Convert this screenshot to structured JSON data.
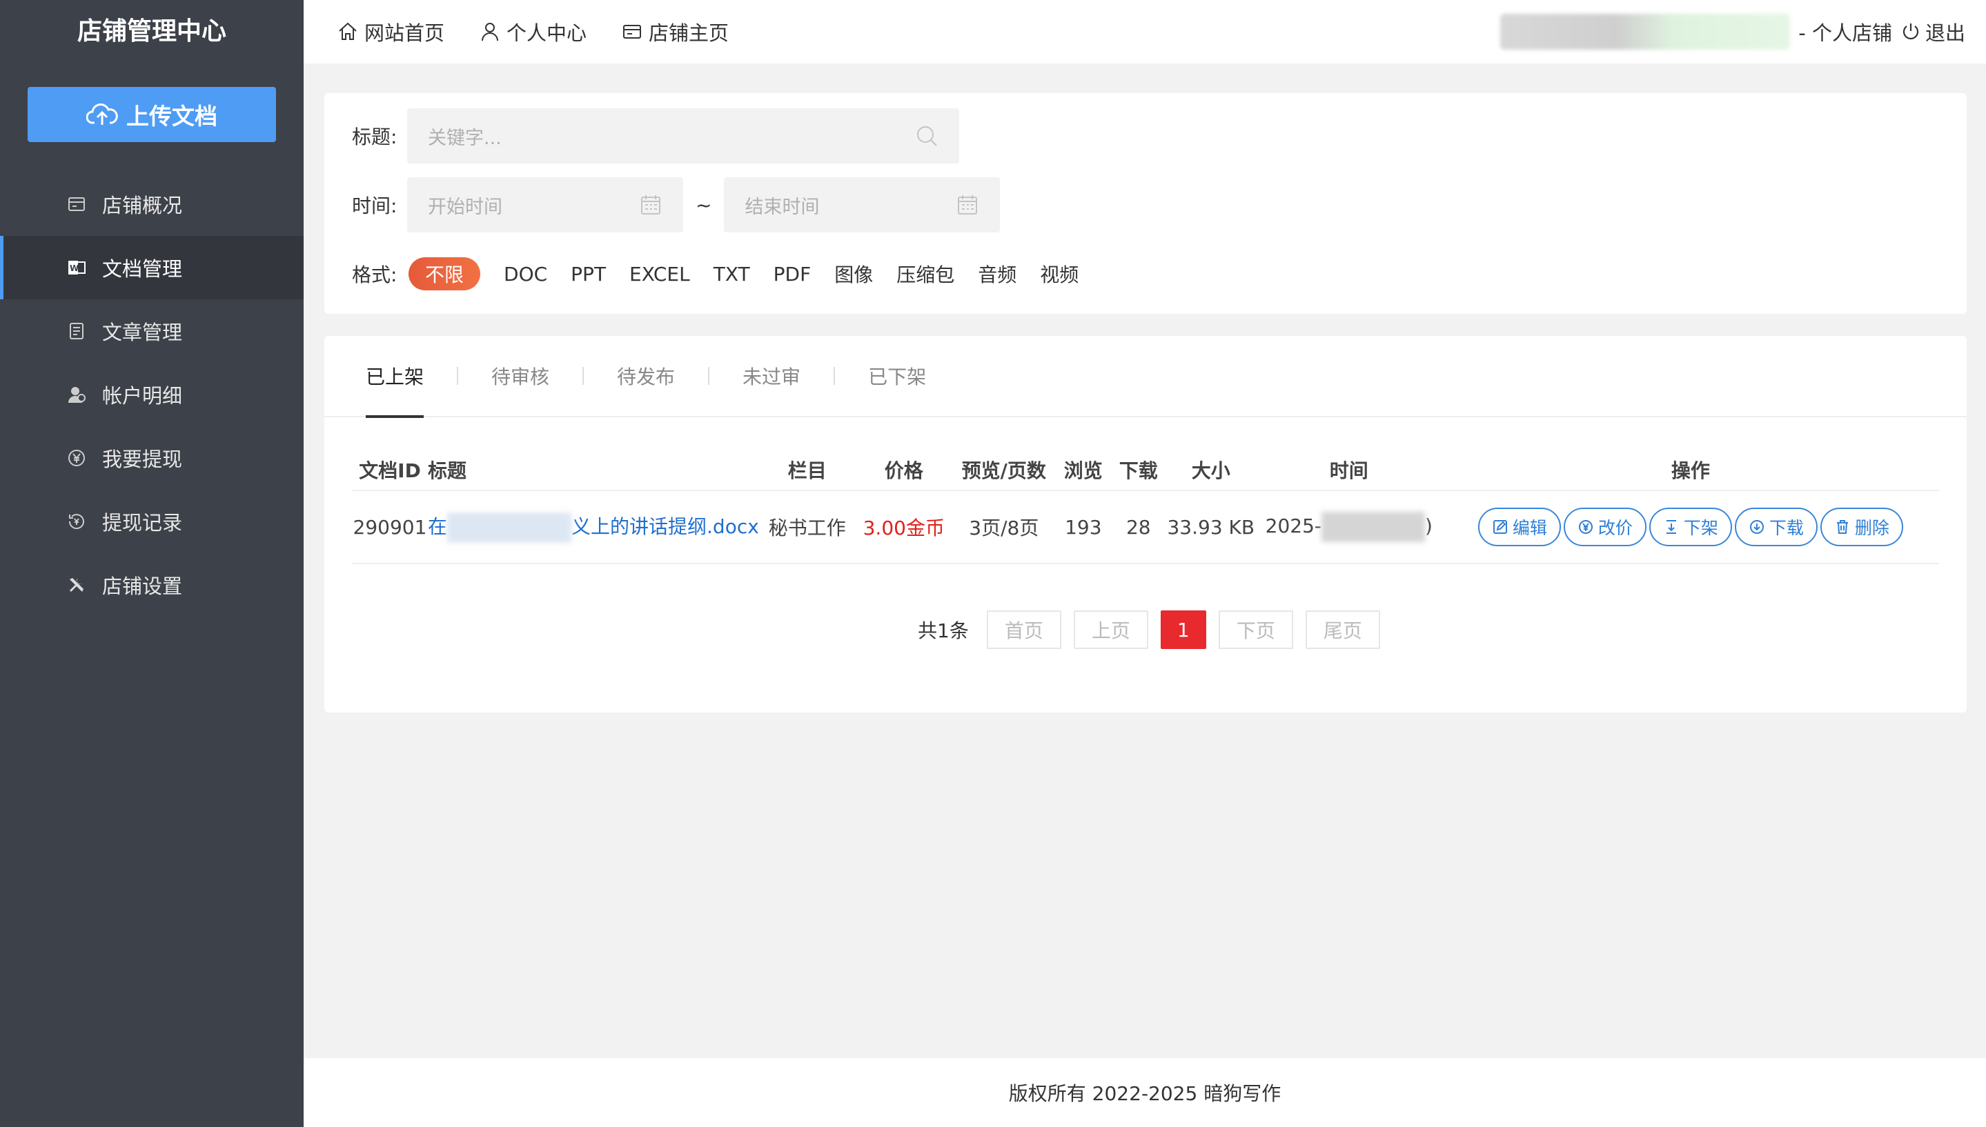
{
  "sidebar": {
    "title": "店铺管理中心",
    "upload_label": "上传文档",
    "items": [
      {
        "label": "店铺概况",
        "icon": "store-icon"
      },
      {
        "label": "文档管理",
        "icon": "word-doc-icon",
        "active": true
      },
      {
        "label": "文章管理",
        "icon": "article-icon"
      },
      {
        "label": "帐户明细",
        "icon": "user-account-icon"
      },
      {
        "label": "我要提现",
        "icon": "yuan-icon"
      },
      {
        "label": "提现记录",
        "icon": "withdraw-record-icon"
      },
      {
        "label": "店铺设置",
        "icon": "tools-icon"
      }
    ]
  },
  "topbar": {
    "links": [
      {
        "label": "网站首页",
        "icon": "home-icon"
      },
      {
        "label": "个人中心",
        "icon": "user-icon"
      },
      {
        "label": "店铺主页",
        "icon": "shop-icon"
      }
    ],
    "shop_label": "- 个人店铺",
    "logout_label": "退出"
  },
  "filters": {
    "title_label": "标题:",
    "title_placeholder": "关键字...",
    "time_label": "时间:",
    "start_placeholder": "开始时间",
    "end_placeholder": "结束时间",
    "tilde": "~",
    "format_label": "格式:",
    "formats": [
      "不限",
      "DOC",
      "PPT",
      "EXCEL",
      "TXT",
      "PDF",
      "图像",
      "压缩包",
      "音频",
      "视频"
    ],
    "active_format": "不限"
  },
  "tabs": [
    "已上架",
    "待审核",
    "待发布",
    "未过审",
    "已下架"
  ],
  "active_tab": "已上架",
  "table": {
    "headers": [
      "文档ID",
      "标题",
      "栏目",
      "价格",
      "预览/页数",
      "浏览",
      "下载",
      "大小",
      "时间",
      "操作"
    ],
    "rows": [
      {
        "id": "290901",
        "title_start": "在",
        "title_end": "义上的讲话提纲.docx",
        "column": "秘书工作",
        "price": "3.00金币",
        "pages": "3页/8页",
        "views": "193",
        "downloads": "28",
        "size": "33.93 KB",
        "time_start": "2025-",
        "time_end": ")"
      }
    ],
    "ops": [
      {
        "label": "编辑",
        "icon": "edit-icon"
      },
      {
        "label": "改价",
        "icon": "price-icon"
      },
      {
        "label": "下架",
        "icon": "unshelve-icon"
      },
      {
        "label": "下载",
        "icon": "download-icon"
      },
      {
        "label": "删除",
        "icon": "trash-icon"
      }
    ]
  },
  "pagination": {
    "total": "共1条",
    "first": "首页",
    "prev": "上页",
    "current": "1",
    "next": "下页",
    "last": "尾页"
  },
  "footer": "版权所有 2022-2025 暗狗写作",
  "colors": {
    "sidebar_bg": "#3d4149",
    "accent": "#4f9cf4",
    "price": "#e0221b",
    "active_format": "#e55a3a",
    "page_current": "#e8292d"
  }
}
